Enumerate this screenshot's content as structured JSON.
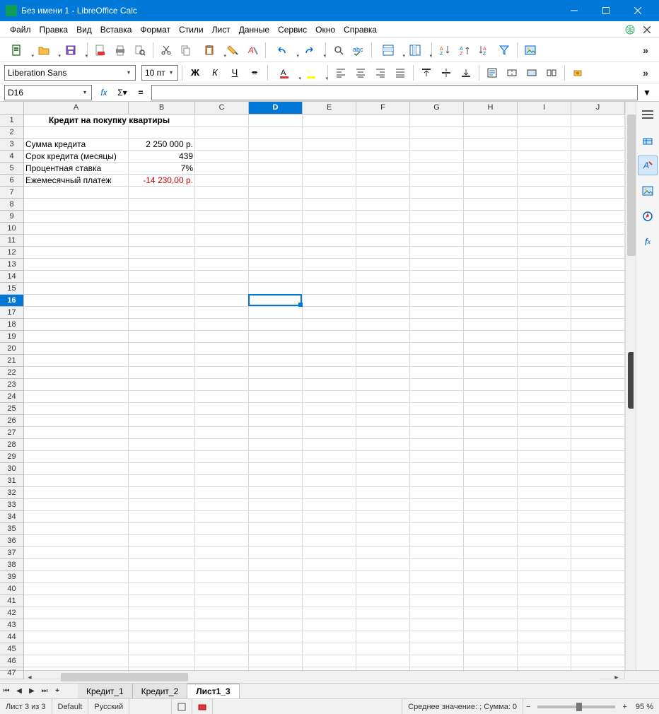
{
  "title": "Без имени 1 - LibreOffice Calc",
  "menus": [
    "Файл",
    "Правка",
    "Вид",
    "Вставка",
    "Формат",
    "Стили",
    "Лист",
    "Данные",
    "Сервис",
    "Окно",
    "Справка"
  ],
  "font_name": "Liberation Sans",
  "font_size": "10 пт",
  "namebox": "D16",
  "columns": [
    "A",
    "B",
    "C",
    "D",
    "E",
    "F",
    "G",
    "H",
    "I",
    "J"
  ],
  "selected_col": "D",
  "selected_row": "16",
  "data": {
    "A1": "Кредит на покупку квартиры",
    "A3": "Сумма кредита",
    "B3": "2 250 000 р.",
    "A4": "Срок кредита (месяцы)",
    "B4": "439",
    "A5": "Процентная ставка",
    "B5": "7%",
    "A6": "Ежемесячный платеж",
    "B6": "-14 230,00 р."
  },
  "tabs": [
    "Кредит_1",
    "Кредит_2",
    "Лист1_3"
  ],
  "active_tab": "Лист1_3",
  "status": {
    "sheet": "Лист 3 из 3",
    "style": "Default",
    "lang": "Русский",
    "aggregate": "Среднее значение: ; Сумма: 0",
    "zoom": "95 %"
  }
}
